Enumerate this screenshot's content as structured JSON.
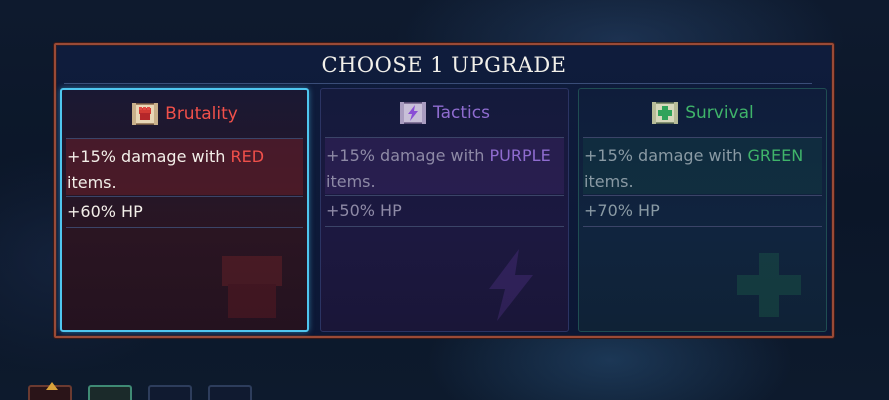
{
  "dialog": {
    "title": "CHOOSE 1 UPGRADE"
  },
  "cards": [
    {
      "name": "Brutality",
      "icon": "red-fist-scroll-icon",
      "color": "#f0504a",
      "selected": true,
      "perk_prefix": "+15% damage with ",
      "perk_keyword": "RED",
      "perk_suffix": " items.",
      "hp_bonus": "+60% HP"
    },
    {
      "name": "Tactics",
      "icon": "purple-lightning-scroll-icon",
      "color": "#8f6cd0",
      "selected": false,
      "perk_prefix": "+15% damage with ",
      "perk_keyword": "PURPLE",
      "perk_suffix": " items.",
      "hp_bonus": "+50% HP"
    },
    {
      "name": "Survival",
      "icon": "green-cross-scroll-icon",
      "color": "#3fb46a",
      "selected": false,
      "perk_prefix": "+15% damage with ",
      "perk_keyword": "GREEN",
      "perk_suffix": " items.",
      "hp_bonus": "+70% HP"
    }
  ],
  "hotbar": {
    "slots": [
      "item-slot",
      "item-slot",
      "item-slot",
      "item-slot"
    ]
  }
}
